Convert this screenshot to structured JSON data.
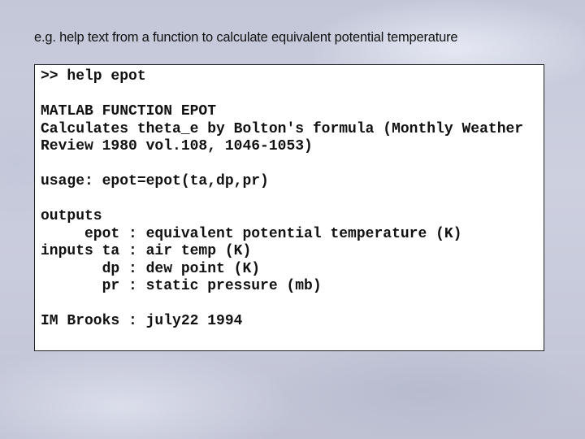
{
  "caption": "e.g. help text from a function to calculate equivalent potential temperature",
  "console": {
    "lines": [
      ">> help epot",
      "",
      "MATLAB FUNCTION EPOT",
      "Calculates theta_e by Bolton's formula (Monthly Weather",
      "Review 1980 vol.108, 1046-1053)",
      "",
      "usage: epot=epot(ta,dp,pr)",
      "",
      "outputs",
      "     epot : equivalent potential temperature (K)",
      "inputs ta : air temp (K)",
      "       dp : dew point (K)",
      "       pr : static pressure (mb)",
      "",
      "IM Brooks : july22 1994"
    ]
  }
}
